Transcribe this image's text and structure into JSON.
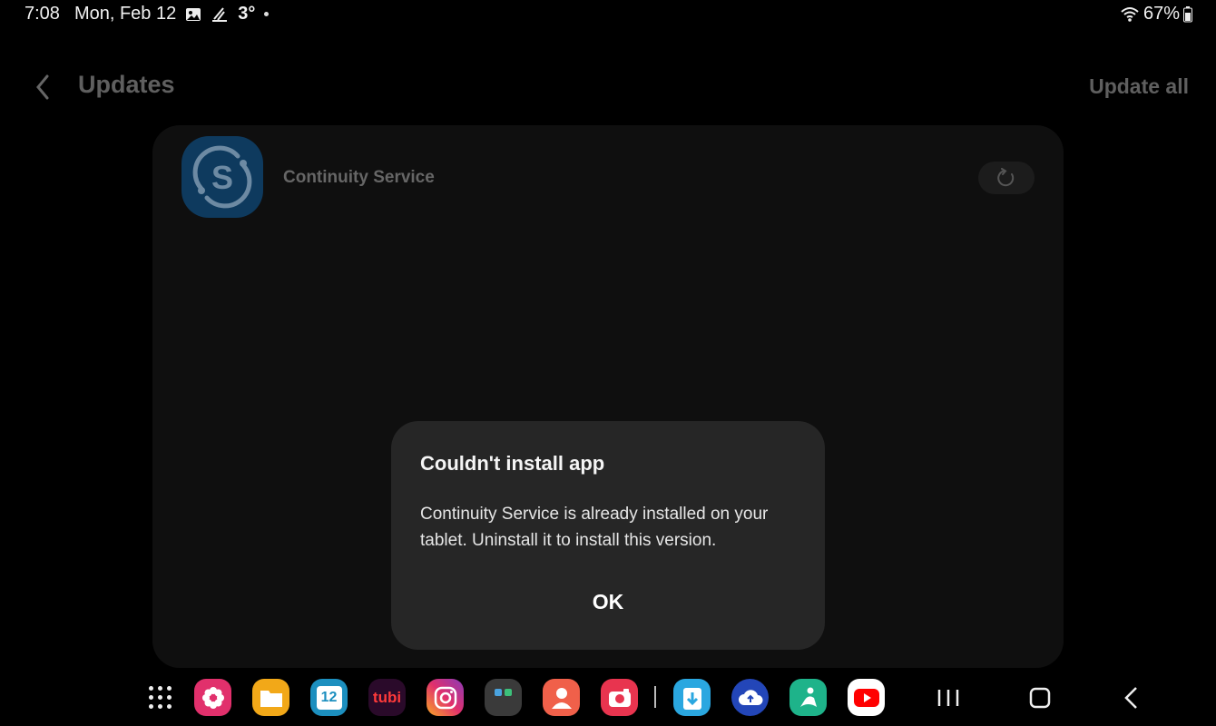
{
  "status": {
    "time": "7:08",
    "date": "Mon, Feb 12",
    "temperature": "3°",
    "battery": "67%"
  },
  "header": {
    "title": "Updates",
    "update_all": "Update all"
  },
  "app_row": {
    "name": "Continuity Service",
    "icon_letter": "S"
  },
  "dialog": {
    "title": "Couldn't install app",
    "message": "Continuity Service is already installed on your tablet. Uninstall it to install this version.",
    "ok_label": "OK"
  },
  "dock": {
    "calendar_day": "12",
    "tubi_label": "tubi",
    "apps": [
      {
        "name": "blossom-app-icon",
        "color": "#e1306c"
      },
      {
        "name": "my-files-icon",
        "color": "#f2a818"
      },
      {
        "name": "calendar-icon",
        "color": "#1c8fbf"
      },
      {
        "name": "tubi-icon",
        "color": "#2a0a2a"
      },
      {
        "name": "instagram-icon",
        "color": "#c13584"
      },
      {
        "name": "folder-icon",
        "color": "#3a3a3a"
      },
      {
        "name": "contacts-icon",
        "color": "#f0604a"
      },
      {
        "name": "camera-icon",
        "color": "#e8344f"
      },
      {
        "name": "downloader-icon",
        "color": "#2aa7e0"
      },
      {
        "name": "cloud-icon",
        "color": "#2346b8"
      },
      {
        "name": "meditation-icon",
        "color": "#1eb38a"
      },
      {
        "name": "youtube-icon",
        "color": "#ffffff"
      }
    ]
  }
}
